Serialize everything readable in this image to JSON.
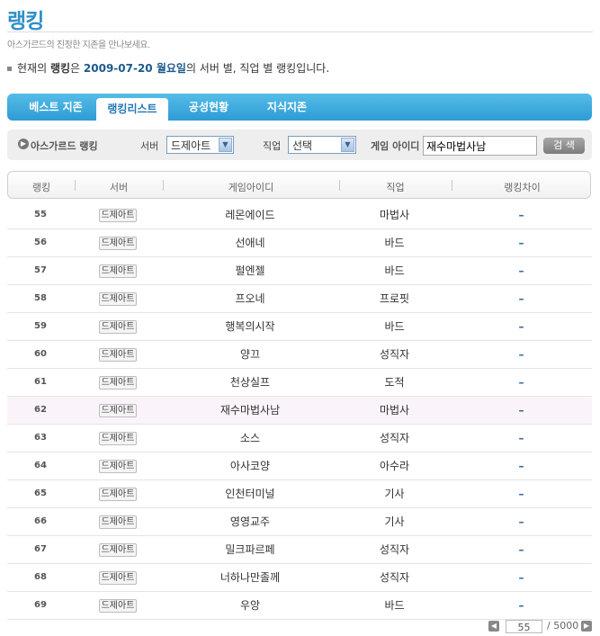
{
  "header": {
    "title": "랭킹",
    "subtitle": "아스가르드의 진정한 지존을 만나보세요.",
    "notice_prefix": "현재의 ",
    "notice_strong": "랭킹",
    "notice_mid": "은 ",
    "notice_date": "2009-07-20 월요일",
    "notice_suffix": "의 서버 별, 직업 별 랭킹입니다."
  },
  "tabs": [
    {
      "label": "베스트 지존",
      "active": false
    },
    {
      "label": "랭킹리스트",
      "active": true
    },
    {
      "label": "공성현황",
      "active": false
    },
    {
      "label": "지식지존",
      "active": false
    }
  ],
  "search": {
    "section_label": "아스가르드 랭킹",
    "server_label": "서버",
    "server_value": "드제아트",
    "job_label": "직업",
    "job_value": "선택",
    "id_label": "게임 아이디",
    "id_value": "재수마법사남",
    "button_label": "검 색"
  },
  "table": {
    "headers": [
      "랭킹",
      "서버",
      "게임아이디",
      "직업",
      "랭킹차이"
    ],
    "rows": [
      {
        "rank": "55",
        "server": "드제아트",
        "id": "레몬에이드",
        "job": "마법사",
        "diff": "–"
      },
      {
        "rank": "56",
        "server": "드제아트",
        "id": "선애네",
        "job": "바드",
        "diff": "–"
      },
      {
        "rank": "57",
        "server": "드제아트",
        "id": "펄엔젤",
        "job": "바드",
        "diff": "–"
      },
      {
        "rank": "58",
        "server": "드제아트",
        "id": "프오네",
        "job": "프로핏",
        "diff": "–"
      },
      {
        "rank": "59",
        "server": "드제아트",
        "id": "행복의시작",
        "job": "바드",
        "diff": "–"
      },
      {
        "rank": "60",
        "server": "드제아트",
        "id": "양끄",
        "job": "성직자",
        "diff": "–"
      },
      {
        "rank": "61",
        "server": "드제아트",
        "id": "천상실프",
        "job": "도적",
        "diff": "–"
      },
      {
        "rank": "62",
        "server": "드제아트",
        "id": "재수마법사남",
        "job": "마법사",
        "diff": "–",
        "highlight": true
      },
      {
        "rank": "63",
        "server": "드제아트",
        "id": "소스",
        "job": "성직자",
        "diff": "–"
      },
      {
        "rank": "64",
        "server": "드제아트",
        "id": "아사코양",
        "job": "아수라",
        "diff": "–"
      },
      {
        "rank": "65",
        "server": "드제아트",
        "id": "인천터미널",
        "job": "기사",
        "diff": "–"
      },
      {
        "rank": "66",
        "server": "드제아트",
        "id": "영영교주",
        "job": "기사",
        "diff": "–"
      },
      {
        "rank": "67",
        "server": "드제아트",
        "id": "밀크파르페",
        "job": "성직자",
        "diff": "–"
      },
      {
        "rank": "68",
        "server": "드제아트",
        "id": "너하나만졸께",
        "job": "성직자",
        "diff": "–"
      },
      {
        "rank": "69",
        "server": "드제아트",
        "id": "우앙",
        "job": "바드",
        "diff": "–"
      }
    ]
  },
  "pager": {
    "current": "55",
    "total": "/ 5000"
  }
}
